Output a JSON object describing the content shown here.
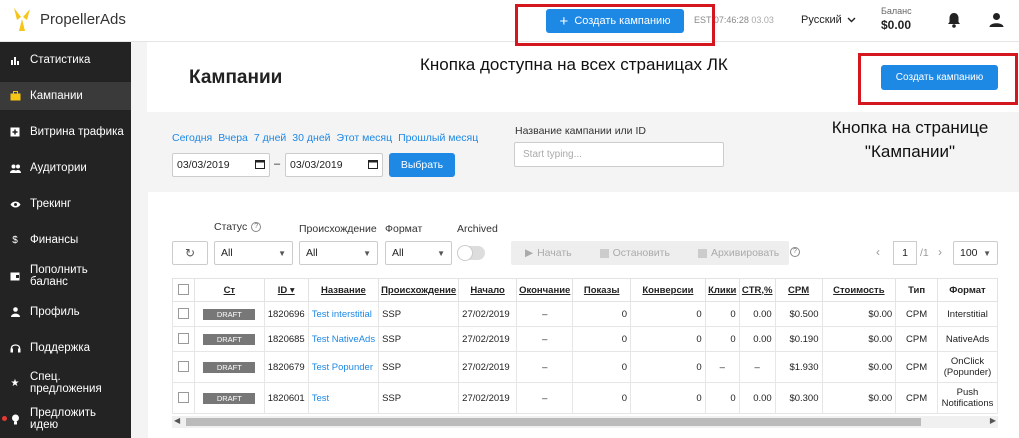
{
  "header": {
    "logo_text": "PropellerAds",
    "create_button": "Создать кампанию",
    "time_label": "EST 07:46:28",
    "time_date": "03.03",
    "language": "Русский",
    "balance_label": "Баланс",
    "balance_value": "$0.00"
  },
  "sidebar": {
    "items": [
      {
        "label": "Статистика",
        "icon": "bar-chart-icon"
      },
      {
        "label": "Кампании",
        "icon": "briefcase-icon"
      },
      {
        "label": "Витрина трафика",
        "icon": "storefront-icon"
      },
      {
        "label": "Аудитории",
        "icon": "people-icon"
      },
      {
        "label": "Трекинг",
        "icon": "eye-icon"
      },
      {
        "label": "Финансы",
        "icon": "dollar-icon"
      },
      {
        "label": "Пополнить баланс",
        "icon": "wallet-icon"
      },
      {
        "label": "Профиль",
        "icon": "person-icon"
      },
      {
        "label": "Поддержка",
        "icon": "headset-icon"
      },
      {
        "label": "Спец. предложения",
        "icon": "star-icon"
      },
      {
        "label": "Предложить идею",
        "icon": "lightbulb-icon"
      }
    ]
  },
  "page": {
    "title": "Кампании",
    "create_button": "Создать кампанию",
    "annotation_top": "Кнопка доступна на всех страницах ЛК",
    "annotation_page": "Кнопка на странице \"Кампании\""
  },
  "filters": {
    "quick": [
      "Сегодня",
      "Вчера",
      "7 дней",
      "30 дней",
      "Этот месяц",
      "Прошлый месяц"
    ],
    "date_from": "03/03/2019",
    "date_to": "03/03/2019",
    "select_button": "Выбрать",
    "name_label": "Название кампании или ID",
    "name_placeholder": "Start typing...",
    "status_label": "Статус",
    "status_value": "All",
    "origin_label": "Происхождение",
    "origin_value": "All",
    "format_label": "Формат",
    "format_value": "All",
    "archived_label": "Archived"
  },
  "actions": {
    "start": "Начать",
    "stop": "Остановить",
    "archive": "Архивировать"
  },
  "pager": {
    "page": "1",
    "of": "/1",
    "per_page": "100"
  },
  "table": {
    "headers": [
      "Ст",
      "ID",
      "Название",
      "Происхождение",
      "Начало",
      "Окончание",
      "Показы",
      "Конверсии",
      "Клики",
      "CTR,%",
      "CPM",
      "Стоимость",
      "Тип",
      "Формат"
    ],
    "rows": [
      {
        "status": "DRAFT",
        "id": "1820696",
        "name": "Test interstitial",
        "origin": "SSP",
        "start": "27/02/2019",
        "end": "–",
        "impressions": "0",
        "conversions": "0",
        "clicks": "0",
        "ctr": "0.00",
        "cpm": "$0.500",
        "cost": "$0.00",
        "type": "CPM",
        "format": "Interstitial"
      },
      {
        "status": "DRAFT",
        "id": "1820685",
        "name": "Test NativeAds",
        "origin": "SSP",
        "start": "27/02/2019",
        "end": "–",
        "impressions": "0",
        "conversions": "0",
        "clicks": "0",
        "ctr": "0.00",
        "cpm": "$0.190",
        "cost": "$0.00",
        "type": "CPM",
        "format": "NativeAds"
      },
      {
        "status": "DRAFT",
        "id": "1820679",
        "name": "Test Popunder",
        "origin": "SSP",
        "start": "27/02/2019",
        "end": "–",
        "impressions": "0",
        "conversions": "0",
        "clicks": "–",
        "ctr": "–",
        "cpm": "$1.930",
        "cost": "$0.00",
        "type": "CPM",
        "format": "OnClick (Popunder)"
      },
      {
        "status": "DRAFT",
        "id": "1820601",
        "name": "Test",
        "origin": "SSP",
        "start": "27/02/2019",
        "end": "–",
        "impressions": "0",
        "conversions": "0",
        "clicks": "0",
        "ctr": "0.00",
        "cpm": "$0.300",
        "cost": "$0.00",
        "type": "CPM",
        "format": "Push Notifications"
      }
    ]
  }
}
